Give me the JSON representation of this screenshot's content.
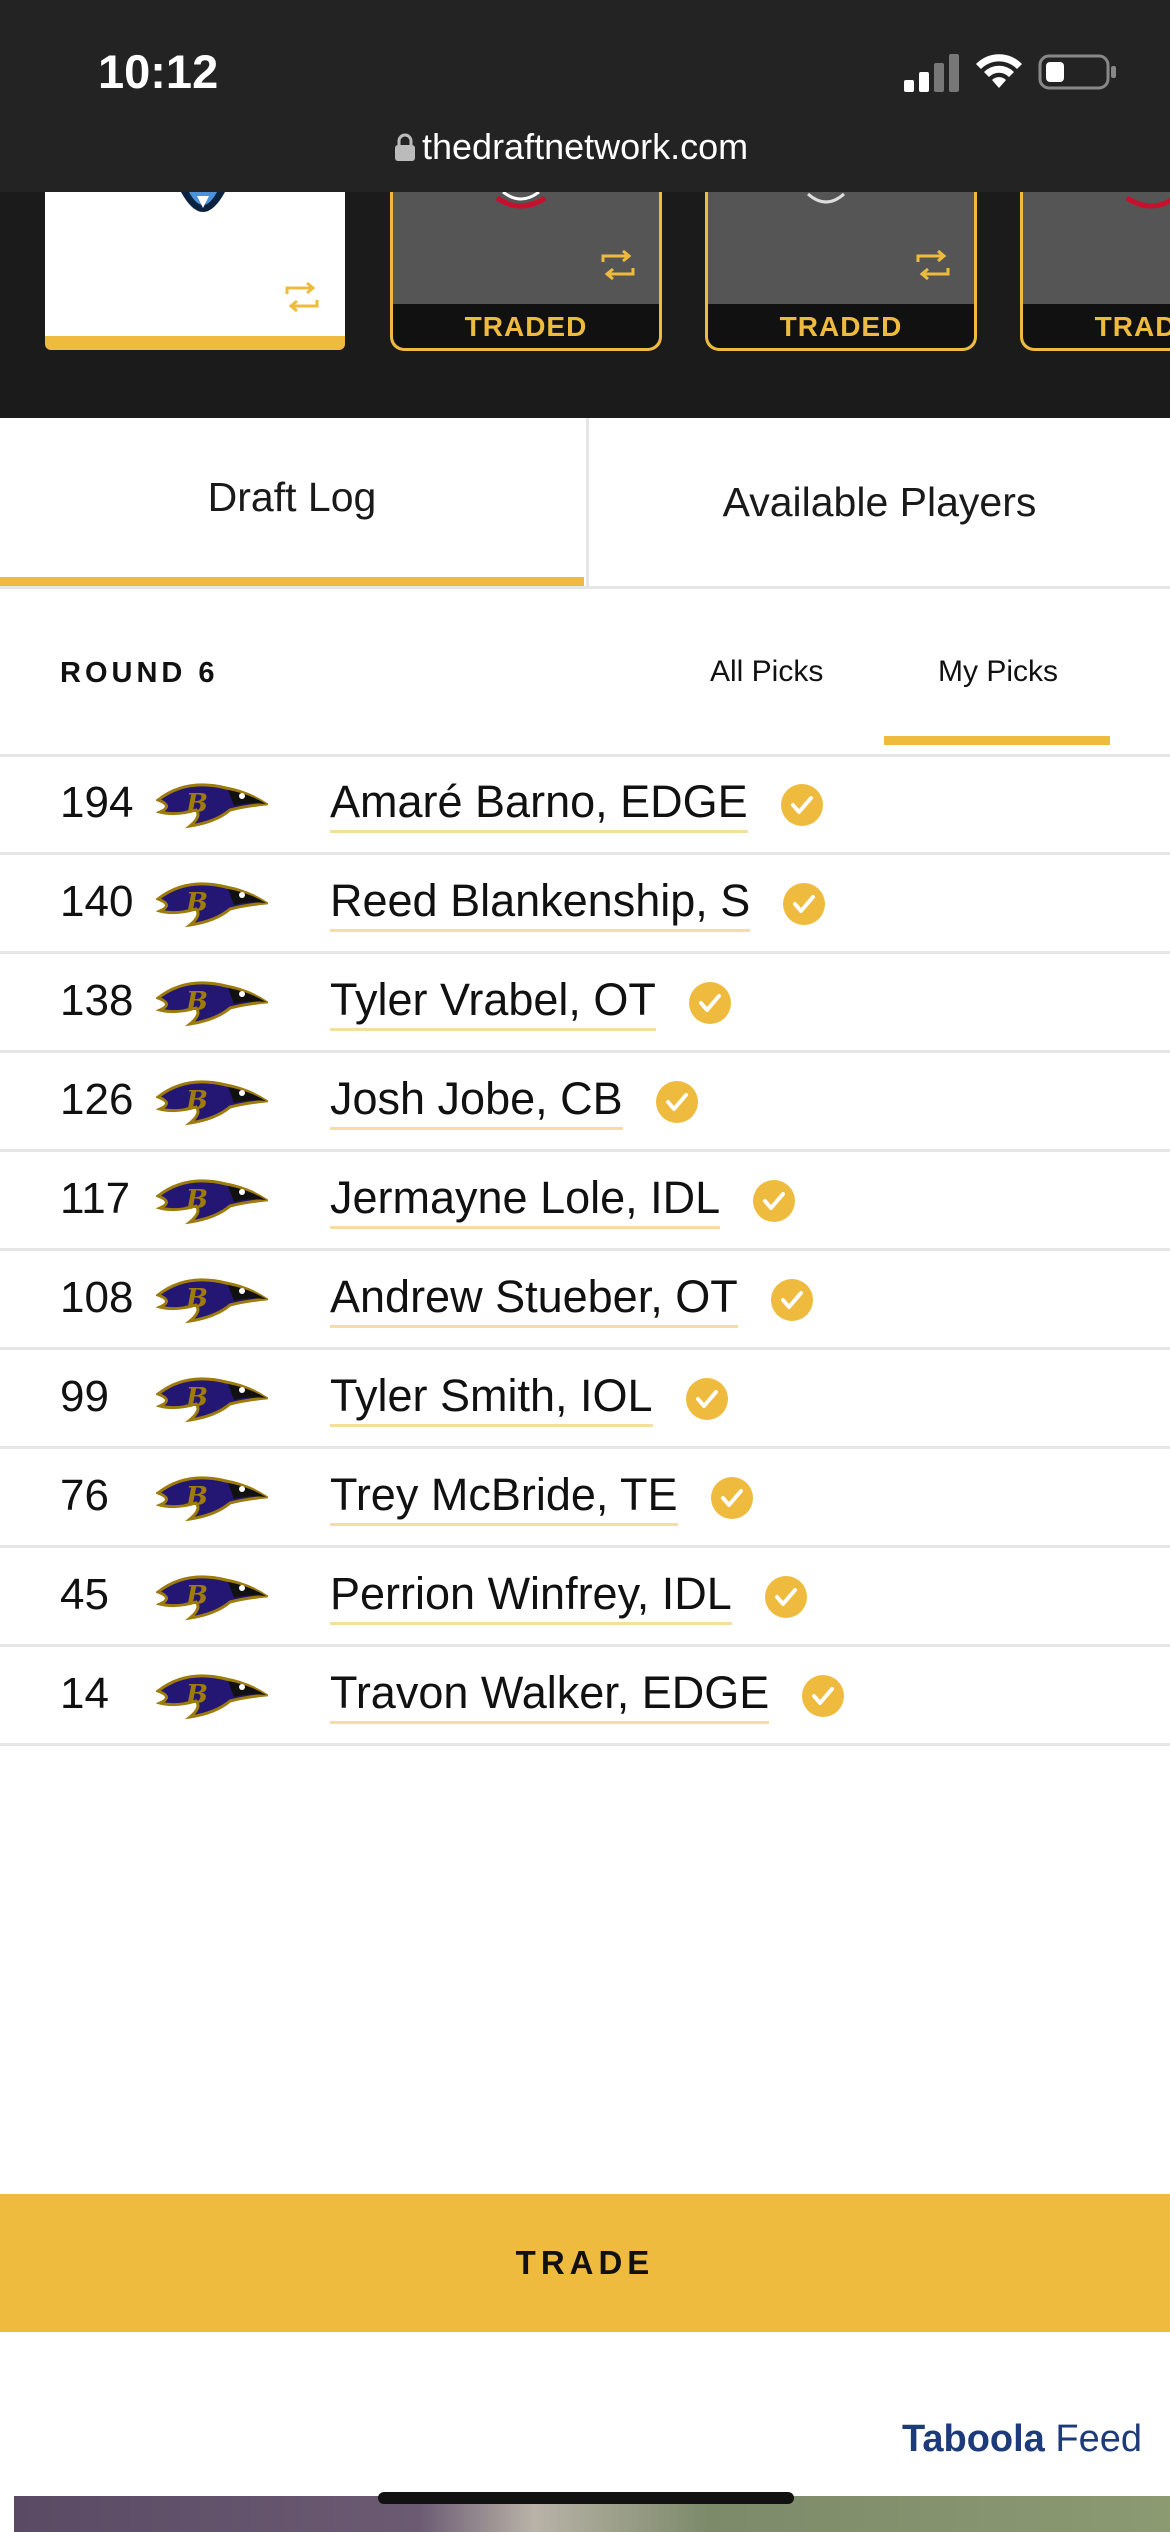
{
  "status_bar": {
    "time": "10:12"
  },
  "browser": {
    "url": "thedraftnetwork.com"
  },
  "pick_strip": {
    "traded_label": "TRADED",
    "cards": [
      {
        "state": "current"
      },
      {
        "state": "traded"
      },
      {
        "state": "traded"
      },
      {
        "state": "traded"
      }
    ]
  },
  "tabs": [
    {
      "label": "Draft Log",
      "active": true
    },
    {
      "label": "Available Players",
      "active": false
    }
  ],
  "round": {
    "label": "ROUND 6",
    "filters": [
      {
        "label": "All Picks",
        "active": false
      },
      {
        "label": "My Picks",
        "active": true
      }
    ]
  },
  "picks": [
    {
      "pick": "194",
      "player": "Amaré Barno, EDGE"
    },
    {
      "pick": "140",
      "player": "Reed Blankenship, S"
    },
    {
      "pick": "138",
      "player": "Tyler Vrabel, OT"
    },
    {
      "pick": "126",
      "player": "Josh Jobe, CB"
    },
    {
      "pick": "117",
      "player": "Jermayne Lole, IDL"
    },
    {
      "pick": "108",
      "player": "Andrew Stueber, OT"
    },
    {
      "pick": "99",
      "player": "Tyler Smith, IOL"
    },
    {
      "pick": "76",
      "player": "Trey McBride, TE"
    },
    {
      "pick": "45",
      "player": "Perrion Winfrey, IDL"
    },
    {
      "pick": "14",
      "player": "Travon Walker, EDGE"
    }
  ],
  "trade_button": {
    "label": "TRADE"
  },
  "taboola": {
    "brand": "Taboola",
    "feed": "Feed"
  },
  "colors": {
    "accent": "#efbb3e",
    "dark": "#232323",
    "ravens_purple": "#241773"
  },
  "icons": {
    "team_logo": "ravens-logo-icon",
    "drafted": "check-circle-icon",
    "trade": "swap-icon"
  }
}
